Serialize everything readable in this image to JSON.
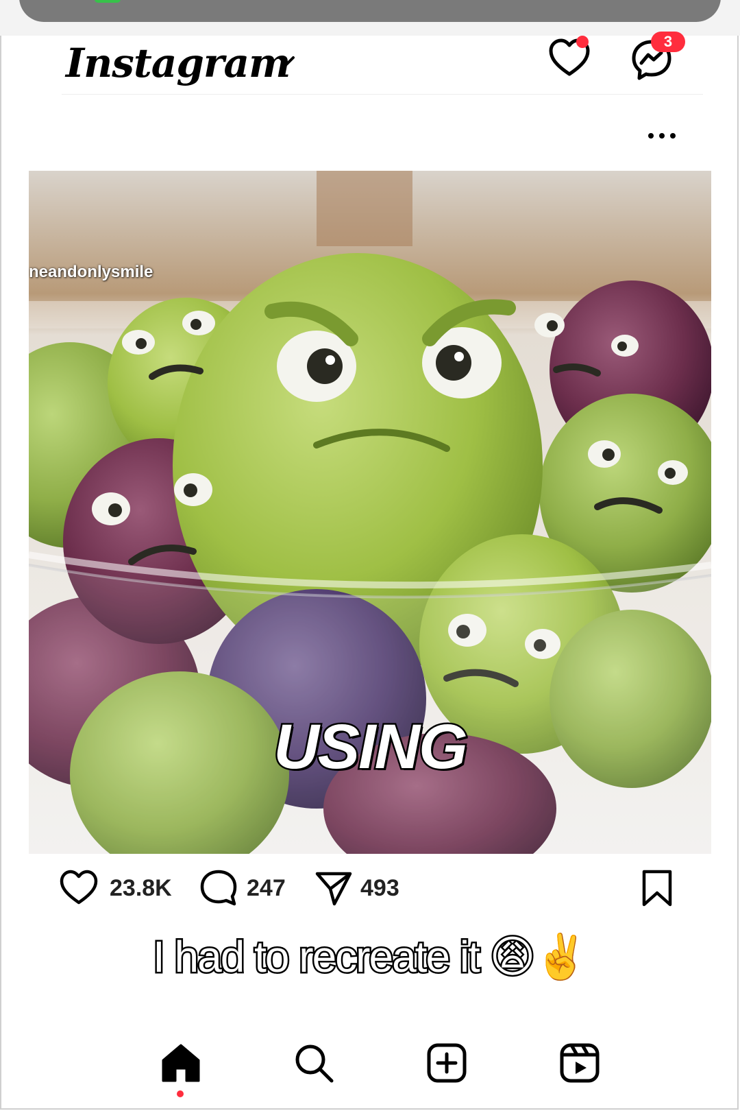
{
  "header": {
    "logo": "Instagram",
    "messages_badge": "3"
  },
  "post": {
    "watermark": "neandonlysmile",
    "overlay_word": "USING"
  },
  "actions": {
    "likes": "23.8K",
    "comments": "247",
    "shares": "493"
  },
  "caption": "I had to recreate it 😩✌️",
  "nav": {
    "items": [
      "home-icon",
      "search-icon",
      "create-icon",
      "reels-icon"
    ]
  },
  "colors": {
    "notification_red": "#ff2d3d",
    "text": "#000000"
  }
}
